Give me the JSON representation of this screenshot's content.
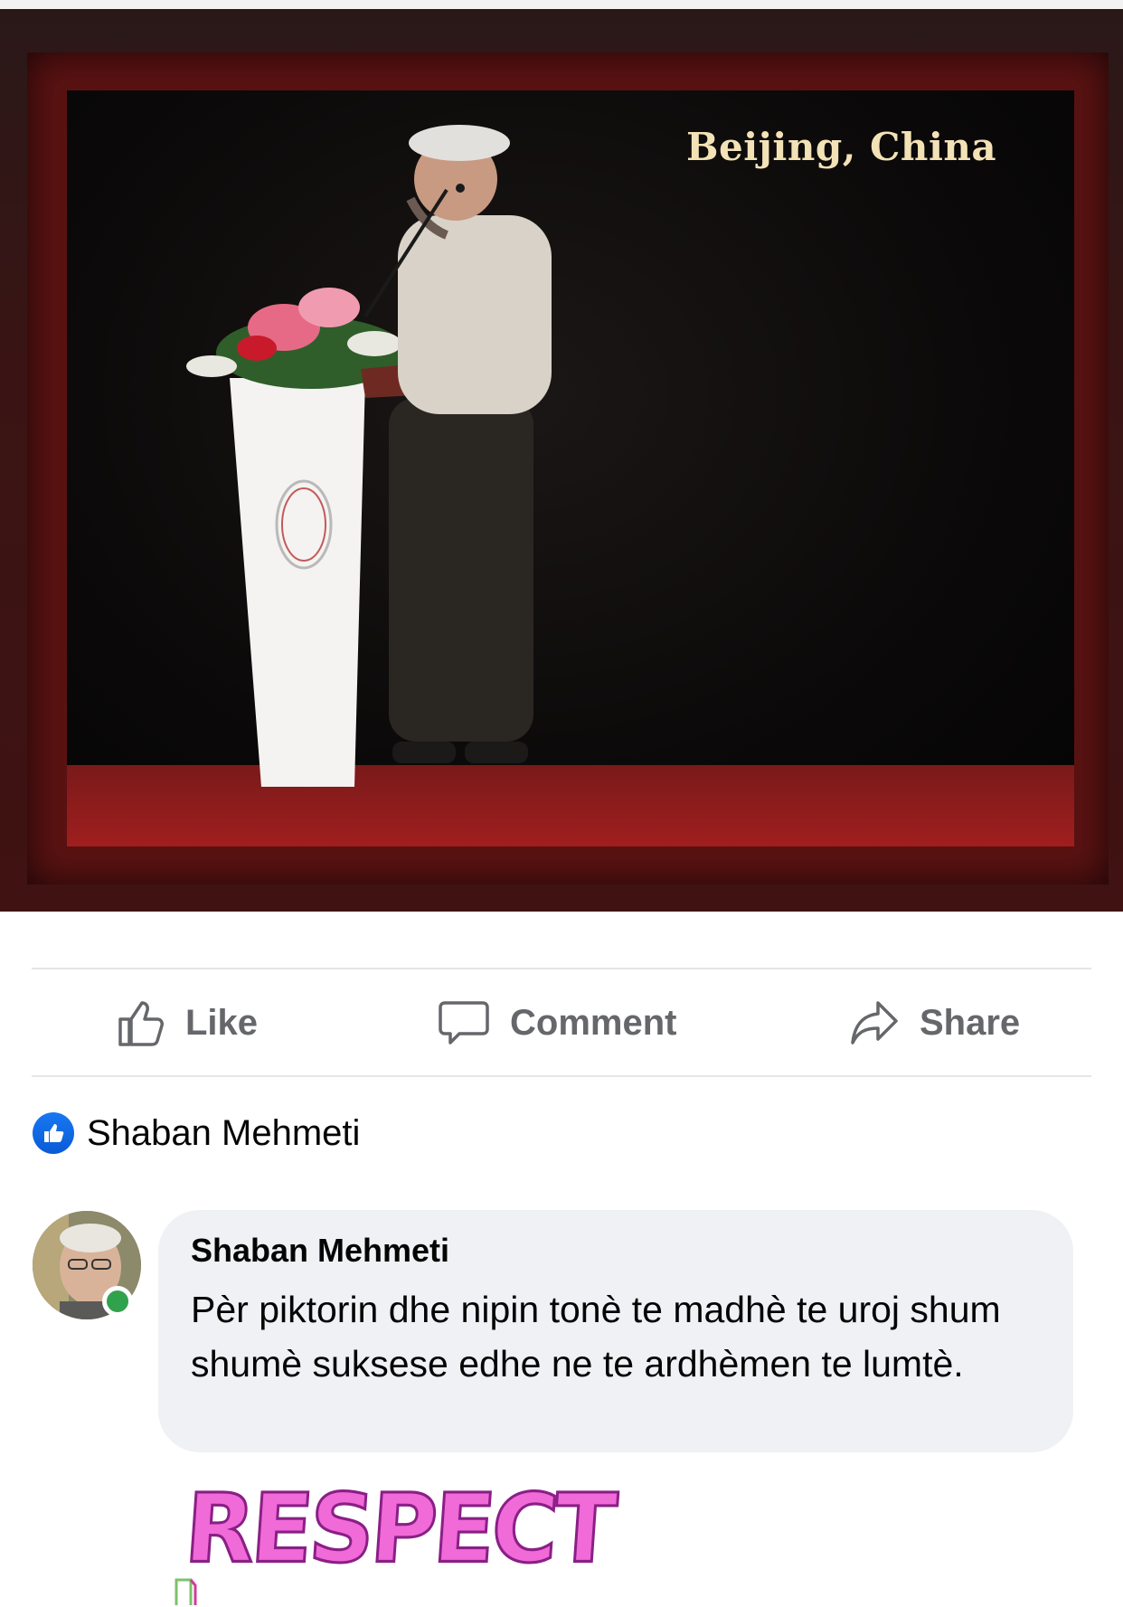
{
  "photo": {
    "caption": "Beijing, China",
    "alt": "Speaker at a podium on stage"
  },
  "actions": {
    "like": "Like",
    "comment": "Comment",
    "share": "Share"
  },
  "reactions": {
    "reactor_name": "Shaban Mehmeti",
    "icon": "like-thumb-icon"
  },
  "comment": {
    "author": "Shaban Mehmeti",
    "text": "Pèr piktorin dhe nipin tonè te madhè te uroj shum shumè suksese edhe ne te ardhèmen te lumtè.",
    "sticker_text": "RESPECT",
    "online": true
  },
  "colors": {
    "accent": "#1877f2",
    "action_text": "#65676b",
    "bubble_bg": "#eff1f4",
    "online": "#31a24c",
    "sticker": "#f06ad8"
  }
}
